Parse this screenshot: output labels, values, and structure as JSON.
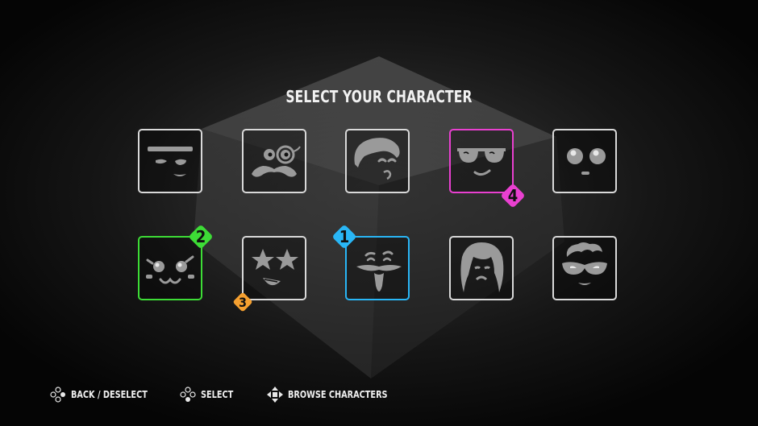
{
  "title": "SELECT YOUR CHARACTER",
  "characters": [
    {
      "row": 1,
      "col": 1,
      "face": "unibrow-squint-face",
      "selected_by": null
    },
    {
      "row": 1,
      "col": 2,
      "face": "monocle-mustache-face",
      "selected_by": null
    },
    {
      "row": 1,
      "col": 3,
      "face": "swoop-hair-face",
      "selected_by": null
    },
    {
      "row": 1,
      "col": 4,
      "face": "sunglasses-face",
      "selected_by": "4"
    },
    {
      "row": 1,
      "col": 5,
      "face": "wide-eyes-face",
      "selected_by": null
    },
    {
      "row": 2,
      "col": 1,
      "face": "sparkle-eyes-face",
      "selected_by": "2"
    },
    {
      "row": 2,
      "col": 2,
      "face": "star-eyes-face",
      "selected_by": "3"
    },
    {
      "row": 2,
      "col": 3,
      "face": "goatee-face",
      "selected_by": "1"
    },
    {
      "row": 2,
      "col": 4,
      "face": "long-hair-face",
      "selected_by": null
    },
    {
      "row": 2,
      "col": 5,
      "face": "quiff-glasses-face",
      "selected_by": null
    }
  ],
  "players": [
    {
      "number": "1",
      "color": "#29b6f6"
    },
    {
      "number": "2",
      "color": "#3ddc36"
    },
    {
      "number": "3",
      "color": "#f5a030"
    },
    {
      "number": "4",
      "color": "#e940d0"
    }
  ],
  "hints": [
    {
      "icon": "button-right-dpad-icon",
      "label": "BACK / DESELECT"
    },
    {
      "icon": "button-bottom-dpad-icon",
      "label": "SELECT"
    },
    {
      "icon": "dpad-arrows-icon",
      "label": "BROWSE CHARACTERS"
    }
  ],
  "colors": {
    "frame": "#d9d9d9",
    "face": "#9a9a9a",
    "background": "#050505"
  }
}
